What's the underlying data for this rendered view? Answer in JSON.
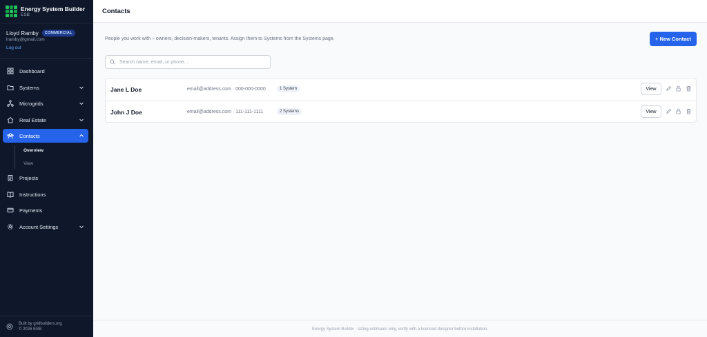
{
  "brand": {
    "title": "Energy System Builder",
    "subtitle": "ESB",
    "accent": "#22c55e"
  },
  "user": {
    "name": "Lloyd Ramby",
    "plan": "COMMERCIAL",
    "email": "lramby@gmail.com",
    "logout_label": "Log out"
  },
  "sidebar": {
    "items": [
      {
        "label": "Dashboard",
        "icon": "layout-grid-icon"
      },
      {
        "label": "Systems",
        "icon": "folder-icon"
      },
      {
        "label": "Microgrids",
        "icon": "network-icon"
      },
      {
        "label": "Real Estate",
        "icon": "home-icon"
      },
      {
        "label": "Contacts",
        "icon": "contacts-icon"
      },
      {
        "label": "Projects",
        "icon": "clipboard-icon"
      },
      {
        "label": "Instructions",
        "icon": "book-icon"
      },
      {
        "label": "Payments",
        "icon": "credit-card-icon"
      },
      {
        "label": "Account Settings",
        "icon": "gear-icon"
      }
    ],
    "active": "Contacts",
    "contacts_sub": [
      {
        "label": "Overview"
      },
      {
        "label": "View"
      }
    ],
    "footer_line1": "Built by gridbuilders.org",
    "footer_line2": "© 2026 ESB"
  },
  "header": {
    "title": "Contacts"
  },
  "main": {
    "intro": "People you work with – owners, decision-makers, tenants. Assign them to Systems from the Systems page.",
    "new_button": "+ New Contact",
    "search_placeholder": "Search name, email, or phone...",
    "contacts": [
      {
        "name": "Jane L Doe",
        "info": "email@address.com · 000-000-0000",
        "systems": "1 System",
        "view_label": "View"
      },
      {
        "name": "John J Doe",
        "info": "email@address.com · 111-111-1111",
        "systems": "2 Systems",
        "view_label": "View"
      }
    ]
  },
  "footer": {
    "text": "Energy System Builder · sizing estimates only, verify with a licensed designer before installation."
  },
  "colors": {
    "primary": "#2563eb",
    "sidebar_bg": "#0f172a"
  }
}
